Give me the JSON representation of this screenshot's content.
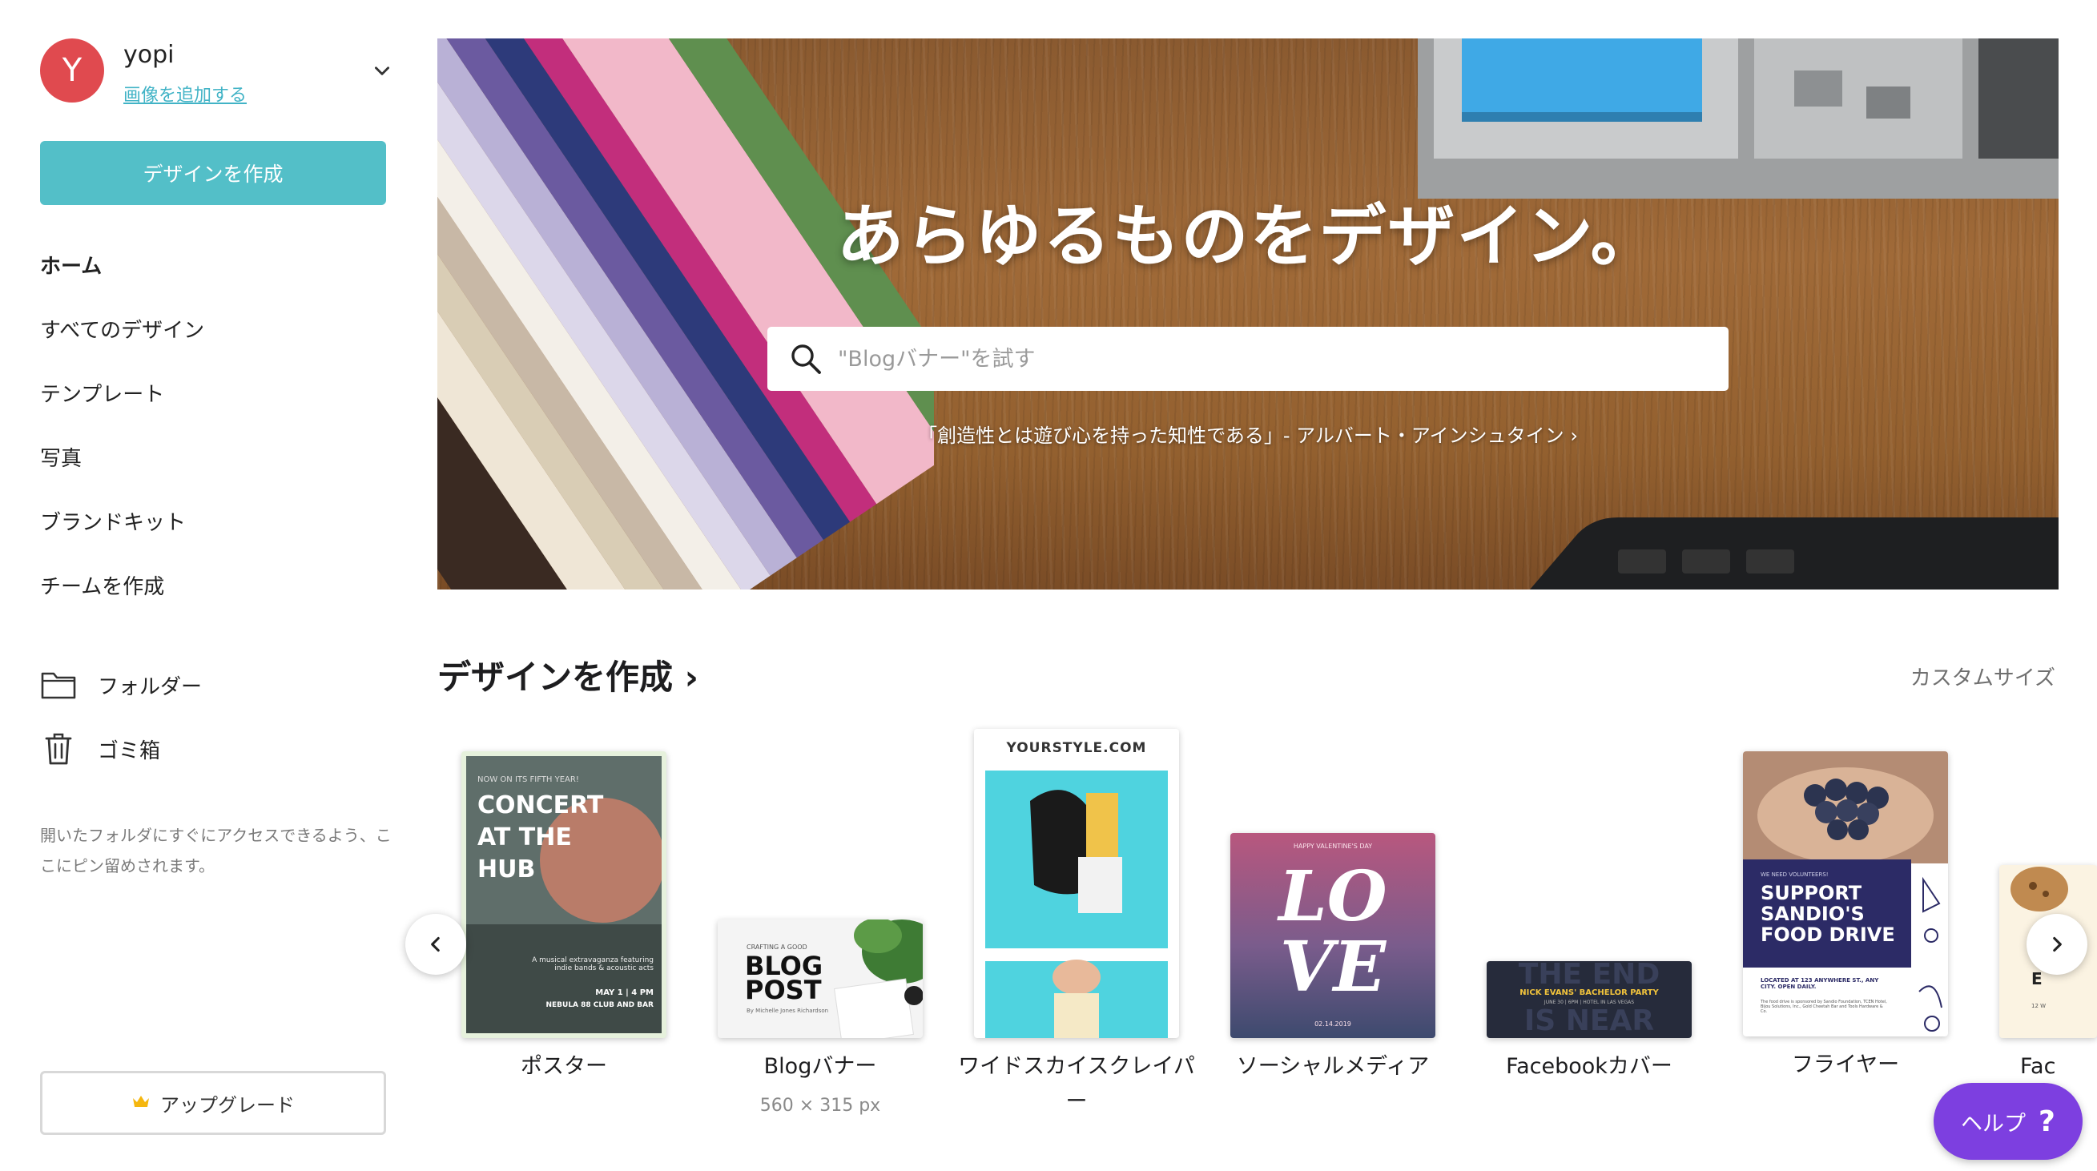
{
  "account": {
    "avatar_initial": "Y",
    "user_name": "yopi",
    "add_image_link": "画像を追加する"
  },
  "sidebar": {
    "create_button": "デザインを作成",
    "nav": [
      {
        "label": "ホーム",
        "active": true
      },
      {
        "label": "すべてのデザイン"
      },
      {
        "label": "テンプレート"
      },
      {
        "label": "写真"
      },
      {
        "label": "ブランドキット"
      },
      {
        "label": "チームを作成"
      }
    ],
    "folders": {
      "label": "フォルダー",
      "icon": "folder-icon"
    },
    "trash": {
      "label": "ゴミ箱",
      "icon": "trash-icon"
    },
    "pin_note": "開いたフォルダにすぐにアクセスできるよう、ここにピン留めされます。",
    "upgrade_button": "アップグレード"
  },
  "hero": {
    "title": "あらゆるものをデザイン。",
    "search_placeholder": "\"Blogバナー\"を試す",
    "quote": "「創造性とは遊び心を持った知性である」- アルバート・アインシュタイン ›"
  },
  "create_section": {
    "title": "デザインを作成 ›",
    "custom_size": "カスタムサイズ",
    "cards": [
      {
        "label": "ポスター",
        "thumb": {
          "small": "NOW ON ITS FIFTH YEAR!",
          "l1": "CONCERT",
          "l2": "AT THE",
          "l3": "HUB",
          "desc": "A musical extravaganza featuring indie bands & acoustic acts",
          "date": "MAY 1 | 4 PM",
          "venue": "NEBULA 88 CLUB AND BAR"
        }
      },
      {
        "label": "Blogバナー",
        "size": "560 × 315 px",
        "thumb": {
          "small": "CRAFTING A GOOD",
          "l1": "BLOG",
          "l2": "POST",
          "byline": "By Michelle Jones Richardson"
        }
      },
      {
        "label": "ワイドスカイスクレイパー",
        "thumb": {
          "url": "YOURSTYLE.COM"
        }
      },
      {
        "label": "ソーシャルメディア",
        "thumb": {
          "small": "HAPPY VALENTINE'S DAY",
          "l1": "LO",
          "l2": "VE",
          "date": "02.14.2019"
        }
      },
      {
        "label": "Facebookカバー",
        "thumb": {
          "bg_text_top": "THE END",
          "headline": "NICK EVANS' BACHELOR PARTY",
          "detail": "JUNE 30 | 6PM | HOTEL IN LAS VEGAS",
          "bg_text_bottom": "IS NEAR"
        }
      },
      {
        "label": "フライヤー",
        "thumb": {
          "small": "WE NEED VOLUNTEERS!",
          "l1": "SUPPORT",
          "l2": "SANDIO'S",
          "l3": "FOOD DRIVE",
          "loc": "LOCATED AT 123 ANYWHERE ST., ANY CITY. OPEN DAILY.",
          "fine": "The food drive is sponsored by Sandio Foundation, TCEN Hotel, Bijou Solutions, Inc., Gold Cheetah Bar and Tools Hardware & Co."
        }
      },
      {
        "label": "Fac",
        "thumb": {
          "letter": "E",
          "fine": "12 W"
        }
      }
    ]
  },
  "help_button": {
    "label": "ヘルプ",
    "icon_text": "?"
  },
  "colors": {
    "accent": "#53bfc8",
    "avatar": "#e04a4f",
    "help": "#7d3fe0",
    "link": "#41b3c6"
  }
}
